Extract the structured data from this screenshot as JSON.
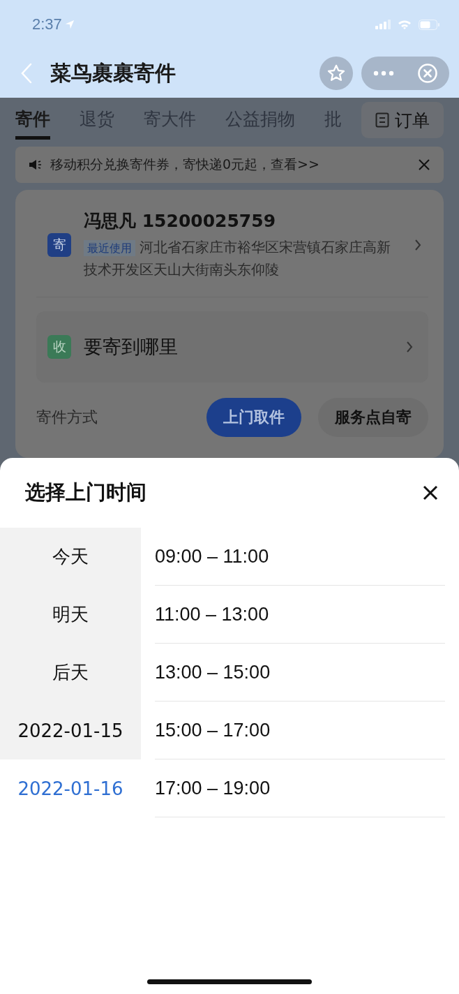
{
  "status_bar": {
    "time": "2:37"
  },
  "nav": {
    "title": "菜鸟裹裹寄件"
  },
  "tabs": [
    {
      "label": "寄件",
      "selected": true
    },
    {
      "label": "退货",
      "selected": false
    },
    {
      "label": "寄大件",
      "selected": false
    },
    {
      "label": "公益捐物",
      "selected": false
    },
    {
      "label": "批",
      "selected": false
    }
  ],
  "orders_button": {
    "label": "订单"
  },
  "notice": {
    "text": "移动积分兑换寄件券，寄快递0元起，查看>>"
  },
  "sender": {
    "badge": "寄",
    "name": "冯思凡 15200025759",
    "tag": "最近使用",
    "address": "河北省石家庄市裕华区宋营镇石家庄高新技术开发区天山大街南头东仰陵"
  },
  "receiver": {
    "badge": "收",
    "prompt": "要寄到哪里"
  },
  "method": {
    "label": "寄件方式",
    "options": [
      {
        "label": "上门取件",
        "selected": true
      },
      {
        "label": "服务点自寄",
        "selected": false
      }
    ]
  },
  "sheet": {
    "title": "选择上门时间",
    "dates": [
      {
        "label": "今天",
        "selected": false
      },
      {
        "label": "明天",
        "selected": false
      },
      {
        "label": "后天",
        "selected": false
      },
      {
        "label": "2022-01-15",
        "selected": false
      },
      {
        "label": "2022-01-16",
        "selected": true
      }
    ],
    "times": [
      {
        "label": "09:00 – 11:00",
        "selected": false
      },
      {
        "label": "11:00 – 13:00",
        "selected": false
      },
      {
        "label": "13:00 – 15:00",
        "selected": false
      },
      {
        "label": "15:00 – 17:00",
        "selected": false
      },
      {
        "label": "17:00 – 19:00",
        "selected": false
      }
    ]
  }
}
